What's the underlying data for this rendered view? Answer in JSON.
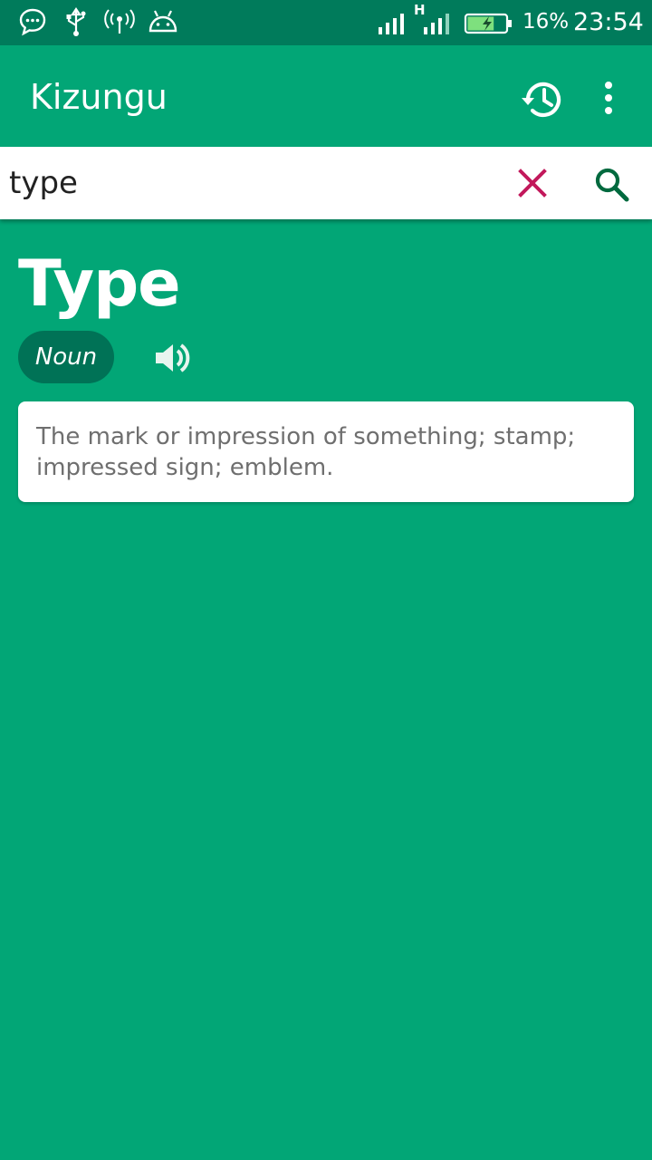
{
  "status_bar": {
    "battery_percent": "16%",
    "time": "23:54",
    "network_label": "H",
    "battery_level": 0.16,
    "icons": [
      "chat-bubble-icon",
      "usb-icon",
      "hotspot-icon",
      "android-debug-icon",
      "signal-icon",
      "battery-charging-icon"
    ]
  },
  "app_bar": {
    "title": "Kizungu",
    "icons": [
      "history-icon",
      "more-vert-icon"
    ]
  },
  "search": {
    "value": "type",
    "clear_icon": "close-icon",
    "search_icon": "search-icon"
  },
  "entry": {
    "word": "Type",
    "part_of_speech": "Noun",
    "audio_icon": "speaker-icon",
    "definition": "The mark or impression of something; stamp; impressed sign; emblem."
  },
  "colors": {
    "primary": "#02a676",
    "primary_dark": "#007b5b",
    "chip": "#007256",
    "clear_icon": "#c2185b",
    "search_icon": "#00693e"
  }
}
